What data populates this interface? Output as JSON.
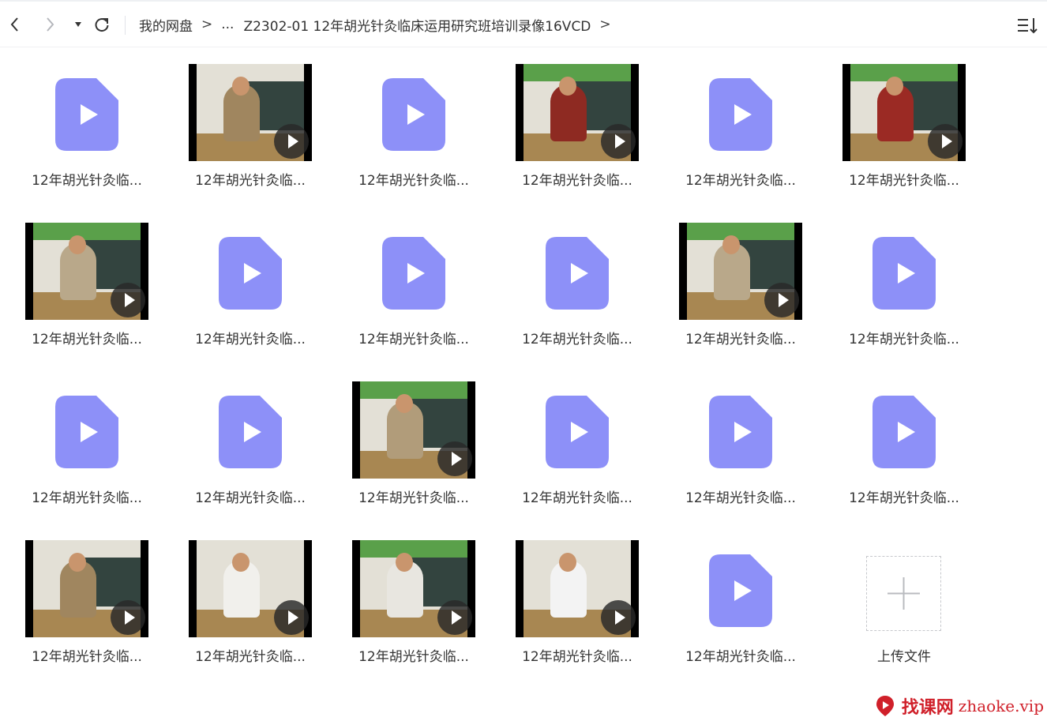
{
  "breadcrumb": {
    "root": "我的网盘",
    "separator": ">",
    "ellipsis": "...",
    "current": "Z2302-01 12年胡光针灸临床运用研究班培训录像16VCD"
  },
  "colors": {
    "accent_file_icon": "#8d90f8",
    "play_badge": "#2a2a2a",
    "watermark": "#d0202a"
  },
  "files": [
    {
      "name": "12年胡光针灸临...",
      "kind": "file-icon"
    },
    {
      "name": "12年胡光针灸临...",
      "kind": "video-thumbnail",
      "scene": "standing-tan"
    },
    {
      "name": "12年胡光针灸临...",
      "kind": "file-icon"
    },
    {
      "name": "12年胡光针灸临...",
      "kind": "video-thumbnail",
      "scene": "board-red"
    },
    {
      "name": "12年胡光针灸临...",
      "kind": "file-icon"
    },
    {
      "name": "12年胡光针灸临...",
      "kind": "video-thumbnail",
      "scene": "red-sweater"
    },
    {
      "name": "12年胡光针灸临...",
      "kind": "video-thumbnail",
      "scene": "classroom"
    },
    {
      "name": "12年胡光针灸临...",
      "kind": "file-icon"
    },
    {
      "name": "12年胡光针灸临...",
      "kind": "file-icon"
    },
    {
      "name": "12年胡光针灸临...",
      "kind": "file-icon"
    },
    {
      "name": "12年胡光针灸临...",
      "kind": "video-thumbnail",
      "scene": "classroom"
    },
    {
      "name": "12年胡光针灸临...",
      "kind": "file-icon"
    },
    {
      "name": "12年胡光针灸临...",
      "kind": "file-icon"
    },
    {
      "name": "12年胡光针灸临...",
      "kind": "file-icon"
    },
    {
      "name": "12年胡光针灸临...",
      "kind": "video-thumbnail",
      "scene": "arms-raised"
    },
    {
      "name": "12年胡光针灸临...",
      "kind": "file-icon"
    },
    {
      "name": "12年胡光针灸临...",
      "kind": "file-icon"
    },
    {
      "name": "12年胡光针灸临...",
      "kind": "file-icon"
    },
    {
      "name": "12年胡光针灸临...",
      "kind": "video-thumbnail",
      "scene": "standing-tan"
    },
    {
      "name": "12年胡光针灸临...",
      "kind": "video-thumbnail",
      "scene": "white-shirt"
    },
    {
      "name": "12年胡光针灸临...",
      "kind": "video-thumbnail",
      "scene": "classroom-students"
    },
    {
      "name": "12年胡光针灸临...",
      "kind": "video-thumbnail",
      "scene": "white-shirt-dark"
    },
    {
      "name": "12年胡光针灸临...",
      "kind": "file-icon"
    }
  ],
  "upload": {
    "label": "上传文件"
  },
  "watermark": {
    "cn": "找课网",
    "en": "zhaoke.vip"
  }
}
